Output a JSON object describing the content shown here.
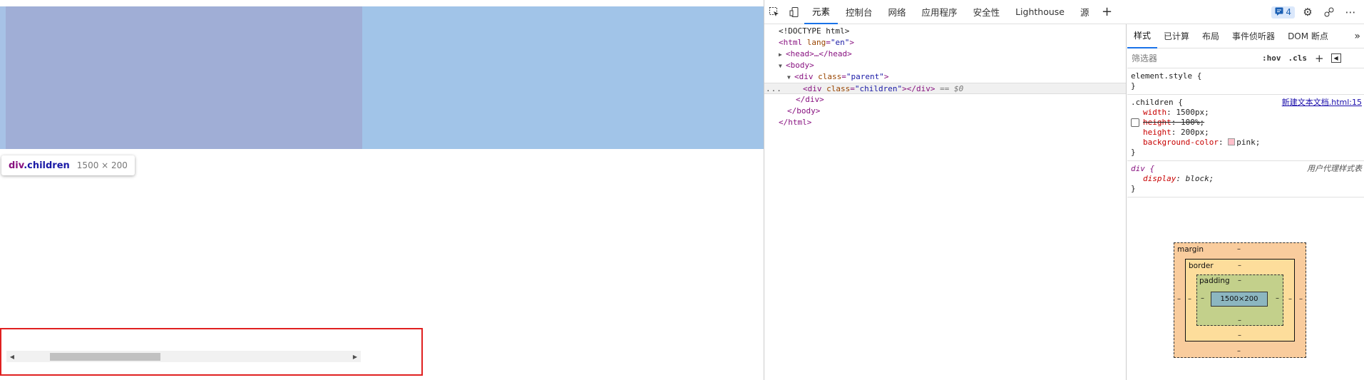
{
  "viewport": {
    "tooltip": {
      "tag": "div",
      "cls": ".children",
      "size": "1500 × 200"
    }
  },
  "devtools": {
    "tabs": [
      "元素",
      "控制台",
      "网络",
      "应用程序",
      "安全性",
      "Lighthouse",
      "源"
    ],
    "active_tab": "元素",
    "issues_count": "4",
    "elements": {
      "doctype": "<!DOCTYPE html>",
      "html_open_tag": "html",
      "html_attr_name": "lang",
      "html_attr_value": "\"en\"",
      "head_collapsed": "<head>…</head>",
      "body_open": "<body>",
      "div_parent_tag": "div",
      "div_parent_attr": "class",
      "div_parent_value": "\"parent\"",
      "div_children_tag": "div",
      "div_children_attr": "class",
      "div_children_value": "\"children\"",
      "div_children_close": "></div>",
      "selected_marker": "== $0",
      "dots": "...",
      "div_close": "</div>",
      "body_close": "</body>",
      "html_close": "</html>"
    },
    "styles": {
      "tabs": [
        "样式",
        "已计算",
        "布局",
        "事件侦听器",
        "DOM 断点"
      ],
      "active_tab": "样式",
      "filter_placeholder": "筛选器",
      "hov": ":hov",
      "cls": ".cls",
      "element_style": "element.style {",
      "close_brace": "}",
      "children_selector": ".children {",
      "source_link": "新建文本文档.html:15",
      "decls": [
        {
          "name": "width",
          "value": "1500px;"
        },
        {
          "name": "height",
          "value": "100%;"
        },
        {
          "name": "height",
          "value": "200px;"
        },
        {
          "name": "background-color",
          "value": "pink;"
        }
      ],
      "ua_selector": "div {",
      "ua_label": "用户代理样式表",
      "ua_decl_name": "display",
      "ua_decl_value": "block;"
    },
    "box_model": {
      "margin_label": "margin",
      "border_label": "border",
      "padding_label": "padding",
      "content_size": "1500×200",
      "dash": "–"
    }
  }
}
